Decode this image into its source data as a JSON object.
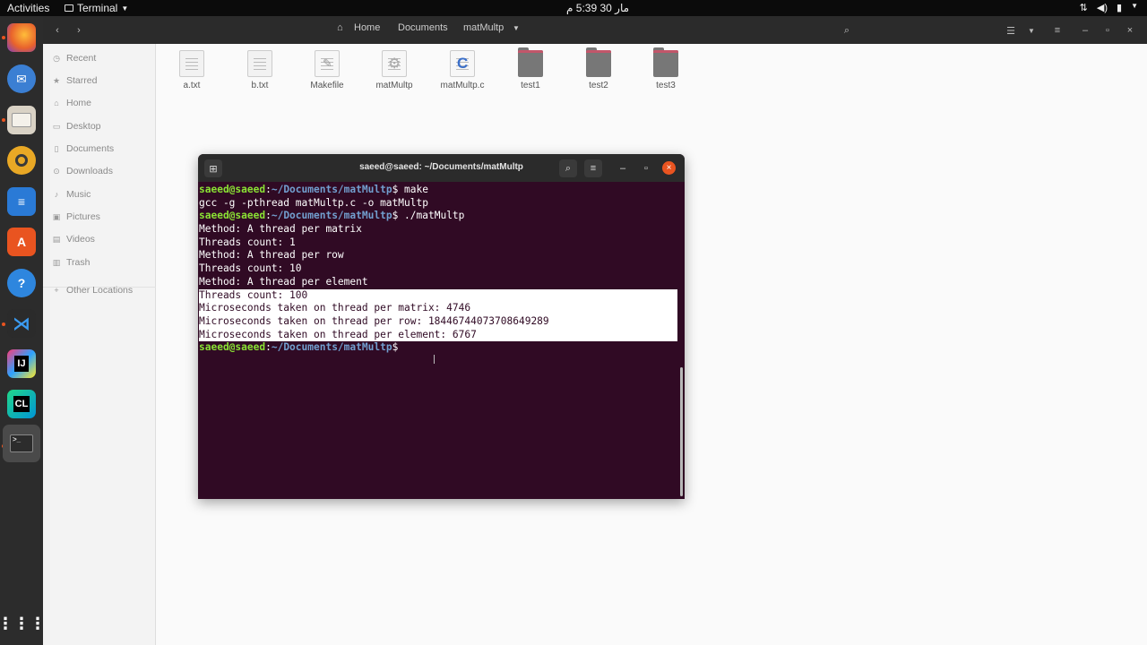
{
  "topbar": {
    "activities": "Activities",
    "app_name": "Terminal",
    "clock": "مار 30  5:39 م"
  },
  "dock": {
    "items": [
      "Firefox",
      "Thunderbird",
      "Files",
      "Rhythmbox",
      "LibreOffice Writer",
      "Ubuntu Software",
      "Help",
      "Visual Studio Code",
      "IntelliJ IDEA",
      "CLion",
      "Terminal",
      "Show Applications"
    ]
  },
  "files": {
    "breadcrumb": [
      "Home",
      "Documents",
      "matMultp"
    ],
    "sidebar": [
      {
        "label": "Recent",
        "icon": "clock-icon"
      },
      {
        "label": "Starred",
        "icon": "star-icon"
      },
      {
        "label": "Home",
        "icon": "home-icon"
      },
      {
        "label": "Desktop",
        "icon": "desktop-icon"
      },
      {
        "label": "Documents",
        "icon": "document-icon"
      },
      {
        "label": "Downloads",
        "icon": "download-icon"
      },
      {
        "label": "Music",
        "icon": "music-icon"
      },
      {
        "label": "Pictures",
        "icon": "picture-icon"
      },
      {
        "label": "Videos",
        "icon": "video-icon"
      },
      {
        "label": "Trash",
        "icon": "trash-icon"
      },
      {
        "label": "Other Locations",
        "icon": "plus-icon"
      }
    ],
    "items": [
      {
        "name": "a.txt",
        "kind": "text"
      },
      {
        "name": "b.txt",
        "kind": "text"
      },
      {
        "name": "Makefile",
        "kind": "make"
      },
      {
        "name": "matMultp",
        "kind": "exec"
      },
      {
        "name": "matMultp.c",
        "kind": "c"
      },
      {
        "name": "test1",
        "kind": "folder"
      },
      {
        "name": "test2",
        "kind": "folder"
      },
      {
        "name": "test3",
        "kind": "folder"
      }
    ]
  },
  "terminal": {
    "title": "saeed@saeed: ~/Documents/matMultp",
    "user_host": "saeed@saeed",
    "path": "~/Documents/matMultp",
    "cmd1": "make",
    "out1": "gcc -g -pthread matMultp.c -o matMultp",
    "cmd2": "./matMultp",
    "lines": [
      "Method: A thread per matrix",
      "Threads count: 1",
      "Method: A thread per row",
      "Threads count: 10",
      "Method: A thread per element"
    ],
    "selected_lines": [
      "Threads count: 100",
      "Microseconds taken on thread per matrix: 4746",
      "Microseconds taken on thread per row: 18446744073708649289",
      "Microseconds taken on thread per element: 6767"
    ]
  }
}
